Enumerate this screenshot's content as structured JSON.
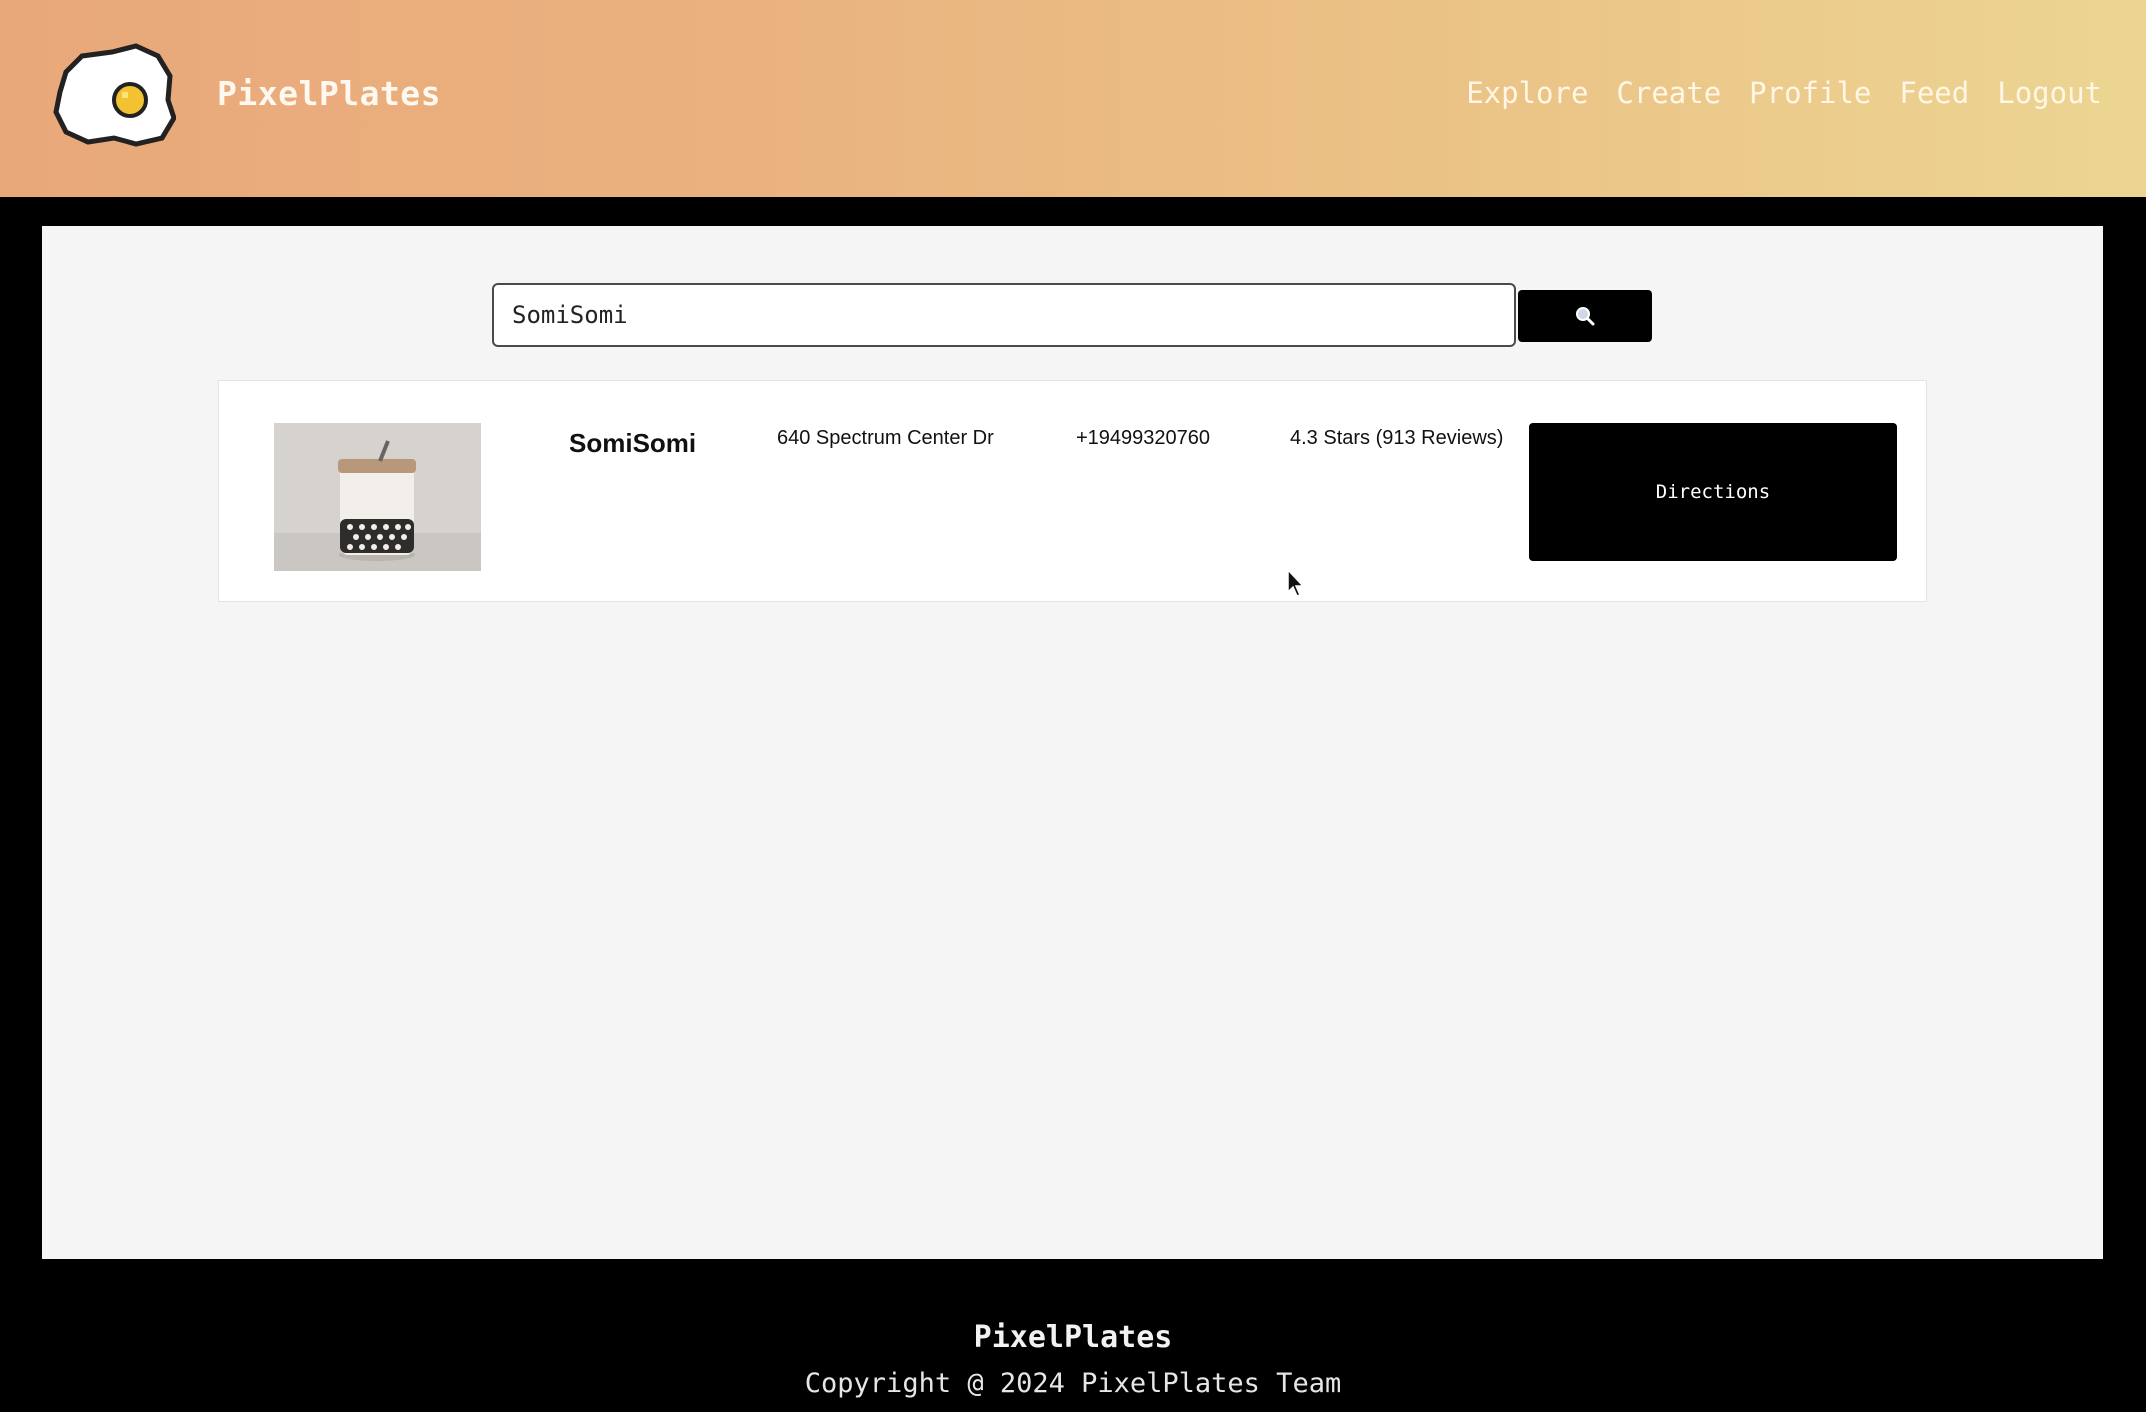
{
  "header": {
    "brand": "PixelPlates",
    "logo_icon": "fried-egg-icon",
    "nav": [
      {
        "label": "Explore"
      },
      {
        "label": "Create"
      },
      {
        "label": "Profile"
      },
      {
        "label": "Feed"
      },
      {
        "label": "Logout"
      }
    ]
  },
  "search": {
    "value": "SomiSomi",
    "button_icon": "search-icon"
  },
  "results": [
    {
      "name": "SomiSomi",
      "address": "640 Spectrum Center Dr",
      "phone": "+19499320760",
      "rating": "4.3 Stars (913 Reviews)",
      "directions_label": "Directions"
    }
  ],
  "footer": {
    "title": "PixelPlates",
    "copyright": "Copyright @ 2024 PixelPlates Team"
  },
  "colors": {
    "header_gradient_start": "#e9a87a",
    "header_gradient_end": "#ecd592",
    "page_background": "#000000",
    "panel_background": "#f5f5f5",
    "button_background": "#000000"
  }
}
